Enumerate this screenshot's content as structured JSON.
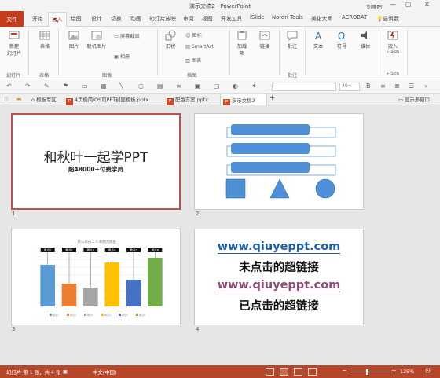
{
  "window": {
    "title": "演示文稿2 - PowerPoint",
    "user": "刘晓阳",
    "minimize": "—",
    "restore": "▢",
    "close": "✕"
  },
  "ribbon_tabs": [
    "文件",
    "开始",
    "插入",
    "绘图",
    "设计",
    "切换",
    "动画",
    "幻灯片放映",
    "审阅",
    "视图",
    "开发工具",
    "iSlide",
    "Nordri Tools",
    "美化大师",
    "ACROBAT"
  ],
  "tell_me": "告诉我",
  "ribbon": {
    "new_slide": "新建\n幻灯片",
    "table": "表格",
    "picture": "图片",
    "online_picture": "联机图片",
    "screenshot": "屏幕截图",
    "album": "相册",
    "shapes": "形状",
    "icons": "图标",
    "smartart": "SmartArt",
    "chart": "图表",
    "addins": "加载\n项",
    "link": "链接",
    "comment": "批注",
    "text": "文本",
    "symbol": "符号",
    "media": "媒体",
    "flash": "嵌入\nFlash",
    "groups": [
      "幻灯片",
      "表格",
      "图像",
      "插图",
      "批注",
      "Flash"
    ]
  },
  "quickbar": {
    "font_size": "40+"
  },
  "doc_tabs": {
    "home": "模板专区",
    "files": [
      "4页极简iOS风PPT封面模板.pptx",
      "配色方案.pptx",
      "演示文稿2"
    ],
    "add": "+",
    "show_multi": "显示多窗口"
  },
  "slides": [
    {
      "num": "1",
      "title": "和秋叶一起学PPT",
      "subtitle": "超48000+付费学员"
    },
    {
      "num": "2"
    },
    {
      "num": "3",
      "chart_title": "某公司员工下滑原因调查",
      "labels": [
        "看点1",
        "看点2",
        "看点3",
        "看点4",
        "看点5",
        "看点6"
      ]
    },
    {
      "num": "4",
      "url1": "www.qiuyeppt.com",
      "text1": "未点击的超链接",
      "url2": "www.qiuyeppt.com",
      "text2": "已点击的超链接"
    }
  ],
  "chart_data": {
    "type": "bar",
    "title": "某公司员工下滑原因调查",
    "categories": [
      "看点1",
      "看点2",
      "看点3",
      "看点4",
      "看点5",
      "看点6"
    ],
    "values": [
      5.3,
      2.9,
      2.4,
      5.6,
      3.4,
      6.2
    ],
    "colors": [
      "#5b9bd5",
      "#ed7d31",
      "#a5a5a5",
      "#ffc000",
      "#4472c4",
      "#70ad47"
    ],
    "ylim": [
      0,
      7
    ]
  },
  "status": {
    "slide": "幻灯片 第 1 张，共 4 张",
    "lang": "中文(中国)",
    "zoom": "125%"
  }
}
